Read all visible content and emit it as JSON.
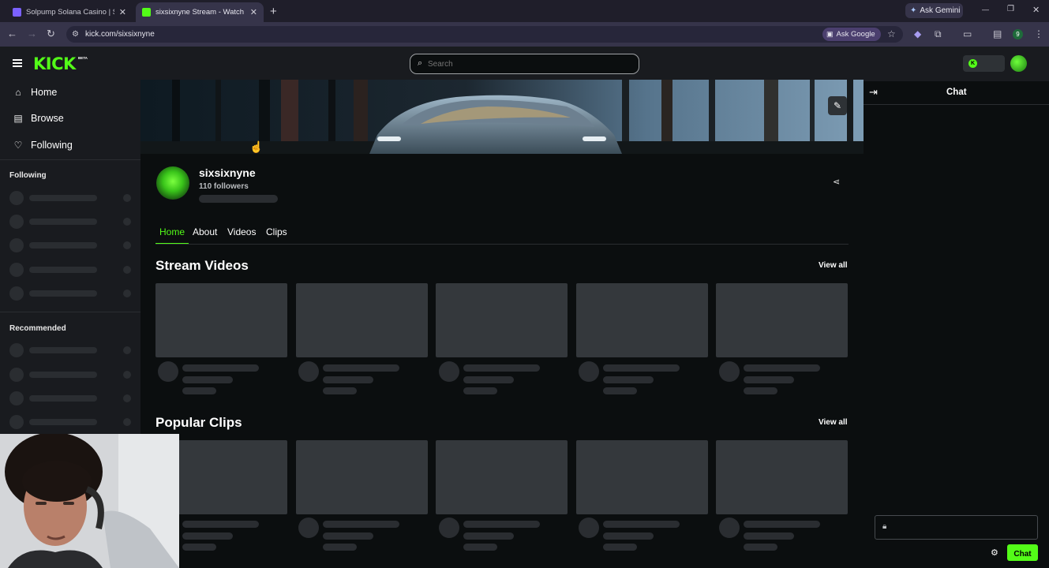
{
  "browser": {
    "tabs": [
      {
        "title": "Solpump Solana Casino | SOL G",
        "active": false
      },
      {
        "title": "sixsixnyne Stream - Watch Live",
        "active": true
      }
    ],
    "new_tab_symbol": "+",
    "gemini_label": "Ask Gemini",
    "url": "kick.com/sixsixnyne",
    "ask_google_label": "Ask Google",
    "profile_initial": "9",
    "window_controls": {
      "minimize": "—",
      "restore": "❐",
      "close": "✕"
    }
  },
  "kick": {
    "logo_text": "KICK",
    "logo_badge": "BETA",
    "search_placeholder": "Search",
    "brand_color": "#53fc18"
  },
  "sidebar": {
    "nav": [
      {
        "label": "Home",
        "icon": "home-icon"
      },
      {
        "label": "Browse",
        "icon": "browse-icon"
      },
      {
        "label": "Following",
        "icon": "heart-icon"
      }
    ],
    "following_title": "Following",
    "recommended_title": "Recommended"
  },
  "channel": {
    "name": "sixsixnyne",
    "followers": "110 followers",
    "tabs": [
      "Home",
      "About",
      "Videos",
      "Clips"
    ],
    "active_tab": "Home"
  },
  "sections": {
    "stream_videos_title": "Stream Videos",
    "stream_videos_view_all": "View all",
    "popular_clips_title": "Popular Clips",
    "popular_clips_view_all": "View all"
  },
  "chat": {
    "title": "Chat",
    "send_label": "Chat"
  }
}
